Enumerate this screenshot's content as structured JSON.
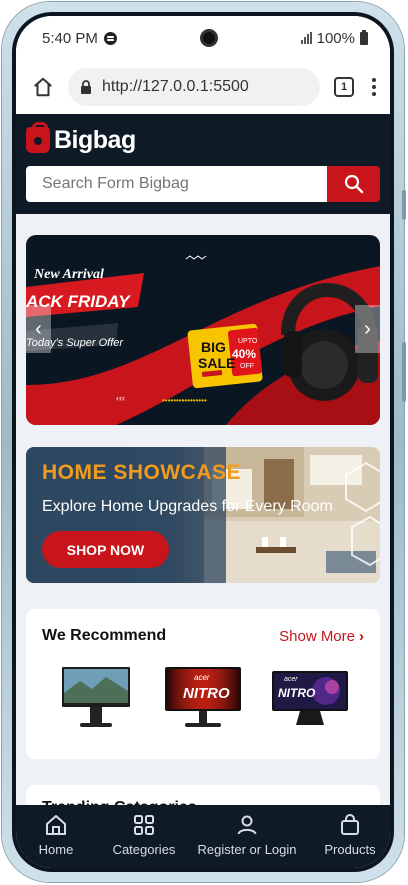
{
  "status_bar": {
    "time": "5:40 PM",
    "battery": "100%"
  },
  "browser": {
    "url": "http://127.0.0.1:5500",
    "tab_count": "1"
  },
  "header": {
    "logo_text": "Bigbag",
    "search_placeholder": "Search Form Bigbag"
  },
  "hero_banner": {
    "tag": "New Arrival",
    "headline": "ACK FRIDAY",
    "offer": "Today's Super Offer",
    "badge_big": "BIG",
    "badge_sale": "SALE",
    "badge_upto": "UPTO",
    "badge_percent": "40%",
    "badge_off": "OFF",
    "colors": {
      "bg": "#0a1622",
      "accent": "#c8141b",
      "badge": "#f7c400"
    }
  },
  "showcase": {
    "title": "HOME SHOWCASE",
    "subtitle": "Explore Home Upgrades for Every Room",
    "button": "SHOP NOW"
  },
  "recommend": {
    "title": "We Recommend",
    "show_more": "Show More",
    "products": [
      {
        "brand": "",
        "label": ""
      },
      {
        "brand": "acer",
        "label": "NITRO"
      },
      {
        "brand": "acer",
        "label": "NITRO"
      }
    ]
  },
  "next_section": {
    "title": "Trending Categories"
  },
  "bottom_nav": {
    "items": [
      {
        "label": "Home",
        "icon": "home-icon"
      },
      {
        "label": "Categories",
        "icon": "grid-icon"
      },
      {
        "label": "Register or Login",
        "icon": "user-icon"
      },
      {
        "label": "Products",
        "icon": "bag-icon"
      }
    ]
  },
  "colors": {
    "brand_red": "#c8141b",
    "dark_navy": "#0e1a25",
    "page_bg": "#eef1f5"
  }
}
